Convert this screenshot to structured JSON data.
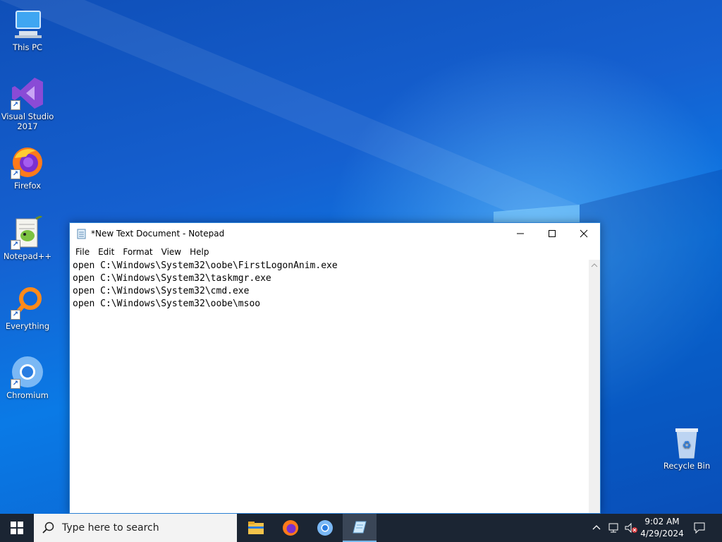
{
  "desktop": {
    "icons": [
      {
        "label": "This PC"
      },
      {
        "label": "Visual Studio 2017"
      },
      {
        "label": "Firefox"
      },
      {
        "label": "Notepad++"
      },
      {
        "label": "Everything"
      },
      {
        "label": "Chromium"
      },
      {
        "label": "Recycle Bin"
      }
    ],
    "accent": "#0a68d8"
  },
  "notepad": {
    "title": "*New Text Document - Notepad",
    "menu": [
      "File",
      "Edit",
      "Format",
      "View",
      "Help"
    ],
    "content": "open C:\\Windows\\System32\\oobe\\FirstLogonAnim.exe\nopen C:\\Windows\\System32\\taskmgr.exe\nopen C:\\Windows\\System32\\cmd.exe\nopen C:\\Windows\\System32\\oobe\\msoo"
  },
  "taskbar": {
    "search_placeholder": "Type here to search",
    "apps": [
      {
        "name": "file-explorer-icon"
      },
      {
        "name": "firefox-icon"
      },
      {
        "name": "chromium-icon"
      },
      {
        "name": "notepad-icon",
        "active": true
      }
    ],
    "time": "9:02 AM",
    "date": "4/29/2024"
  }
}
